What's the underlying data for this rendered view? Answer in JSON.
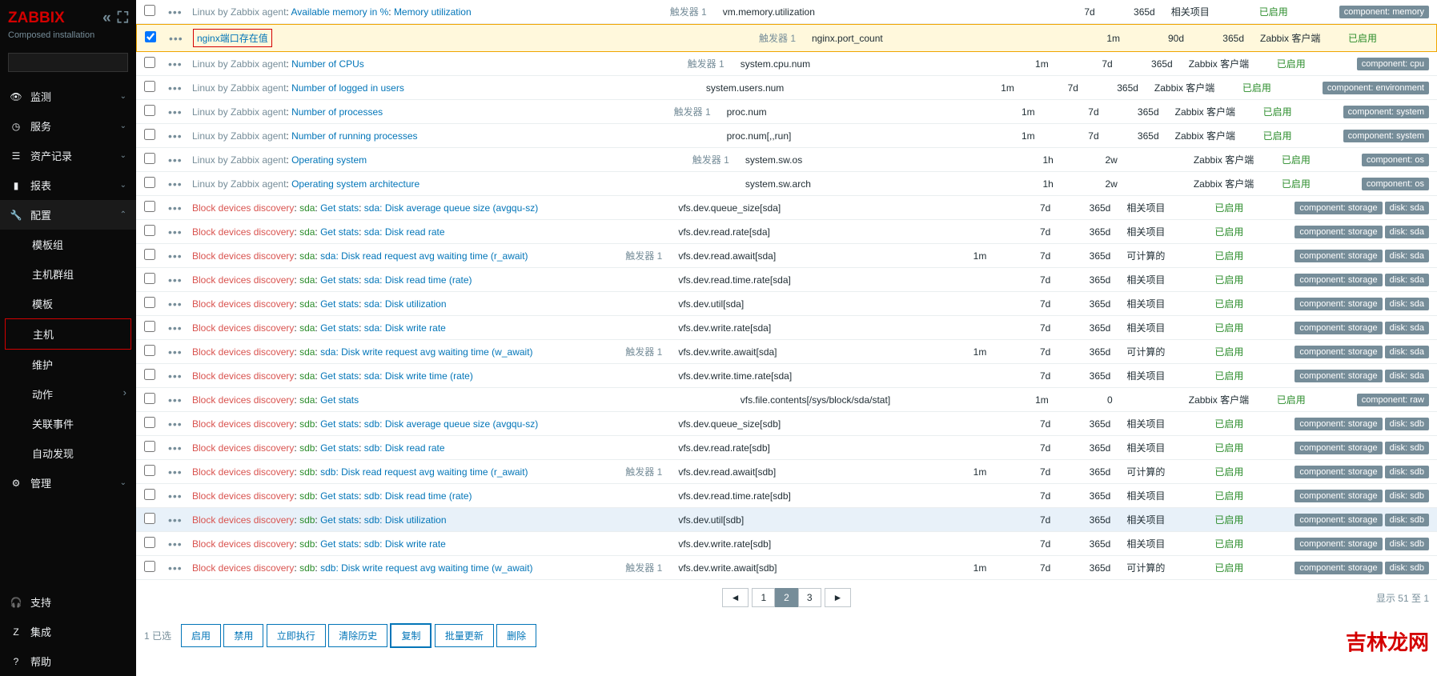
{
  "brand": "ZABBIX",
  "subtitle": "Composed installation",
  "nav": [
    {
      "label": "监测",
      "icon": "eye",
      "chevron": "down"
    },
    {
      "label": "服务",
      "icon": "clock",
      "chevron": "down"
    },
    {
      "label": "资产记录",
      "icon": "list",
      "chevron": "down"
    },
    {
      "label": "报表",
      "icon": "chart",
      "chevron": "down"
    },
    {
      "label": "配置",
      "icon": "wrench",
      "chevron": "up",
      "sub": [
        {
          "label": "模板组"
        },
        {
          "label": "主机群组"
        },
        {
          "label": "模板"
        },
        {
          "label": "主机",
          "boxed": true
        },
        {
          "label": "维护"
        },
        {
          "label": "动作",
          "chevron": "right"
        },
        {
          "label": "关联事件"
        },
        {
          "label": "自动发现"
        }
      ]
    },
    {
      "label": "管理",
      "icon": "gear",
      "chevron": "down"
    }
  ],
  "bottom_nav": [
    {
      "label": "支持",
      "icon": "headset"
    },
    {
      "label": "集成",
      "icon": "z"
    },
    {
      "label": "帮助",
      "icon": "question"
    }
  ],
  "trigger_label": "触发器",
  "status_enabled": "已启用",
  "rows": [
    {
      "prefix_parts": [
        {
          "t": "Linux by Zabbix agent",
          "c": "gray"
        },
        {
          "t": "Available memory in %",
          "c": "blue"
        },
        {
          "t": "Memory utilization",
          "c": "blue"
        }
      ],
      "name": "",
      "trigger": 1,
      "key": "vm.memory.utilization",
      "int": "",
      "hist": "7d",
      "trend": "365d",
      "type": "相关项目",
      "tags": [
        "component: memory"
      ]
    },
    {
      "checked": true,
      "highlight": true,
      "redbox": true,
      "prefix_parts": [],
      "name": "nginx端口存在值",
      "name_c": "blue",
      "trigger": 1,
      "key": "nginx.port_count",
      "int": "1m",
      "hist": "90d",
      "trend": "365d",
      "type": "Zabbix 客户端",
      "tags": []
    },
    {
      "prefix_parts": [
        {
          "t": "Linux by Zabbix agent",
          "c": "gray"
        }
      ],
      "name": "Number of CPUs",
      "name_c": "blue",
      "trigger": 1,
      "key": "system.cpu.num",
      "int": "1m",
      "hist": "7d",
      "trend": "365d",
      "type": "Zabbix 客户端",
      "tags": [
        "component: cpu"
      ]
    },
    {
      "prefix_parts": [
        {
          "t": "Linux by Zabbix agent",
          "c": "gray"
        }
      ],
      "name": "Number of logged in users",
      "name_c": "blue",
      "trigger": "",
      "key": "system.users.num",
      "int": "1m",
      "hist": "7d",
      "trend": "365d",
      "type": "Zabbix 客户端",
      "tags": [
        "component: environment"
      ]
    },
    {
      "prefix_parts": [
        {
          "t": "Linux by Zabbix agent",
          "c": "gray"
        }
      ],
      "name": "Number of processes",
      "name_c": "blue",
      "trigger": 1,
      "key": "proc.num",
      "int": "1m",
      "hist": "7d",
      "trend": "365d",
      "type": "Zabbix 客户端",
      "tags": [
        "component: system"
      ]
    },
    {
      "prefix_parts": [
        {
          "t": "Linux by Zabbix agent",
          "c": "gray"
        }
      ],
      "name": "Number of running processes",
      "name_c": "blue",
      "trigger": "",
      "key": "proc.num[,,run]",
      "int": "1m",
      "hist": "7d",
      "trend": "365d",
      "type": "Zabbix 客户端",
      "tags": [
        "component: system"
      ]
    },
    {
      "prefix_parts": [
        {
          "t": "Linux by Zabbix agent",
          "c": "gray"
        }
      ],
      "name": "Operating system",
      "name_c": "blue",
      "trigger": 1,
      "key": "system.sw.os",
      "int": "1h",
      "hist": "2w",
      "trend": "",
      "type": "Zabbix 客户端",
      "tags": [
        "component: os"
      ]
    },
    {
      "prefix_parts": [
        {
          "t": "Linux by Zabbix agent",
          "c": "gray"
        }
      ],
      "name": "Operating system architecture",
      "name_c": "blue",
      "trigger": "",
      "key": "system.sw.arch",
      "int": "1h",
      "hist": "2w",
      "trend": "",
      "type": "Zabbix 客户端",
      "tags": [
        "component: os"
      ]
    },
    {
      "prefix_parts": [
        {
          "t": "Block devices discovery",
          "c": "orange"
        },
        {
          "t": "sda",
          "c": "green"
        },
        {
          "t": "Get stats",
          "c": "blue"
        }
      ],
      "name": "sda: Disk average queue size (avgqu-sz)",
      "name_c": "blue",
      "trigger": "",
      "key": "vfs.dev.queue_size[sda]",
      "int": "",
      "hist": "7d",
      "trend": "365d",
      "type": "相关项目",
      "tags": [
        "component: storage",
        "disk: sda"
      ]
    },
    {
      "prefix_parts": [
        {
          "t": "Block devices discovery",
          "c": "orange"
        },
        {
          "t": "sda",
          "c": "green"
        },
        {
          "t": "Get stats",
          "c": "blue"
        }
      ],
      "name": "sda: Disk read rate",
      "name_c": "blue",
      "trigger": "",
      "key": "vfs.dev.read.rate[sda]",
      "int": "",
      "hist": "7d",
      "trend": "365d",
      "type": "相关项目",
      "tags": [
        "component: storage",
        "disk: sda"
      ]
    },
    {
      "prefix_parts": [
        {
          "t": "Block devices discovery",
          "c": "orange"
        },
        {
          "t": "sda",
          "c": "green"
        }
      ],
      "name": "sda: Disk read request avg waiting time (r_await)",
      "name_c": "blue",
      "trigger": 1,
      "key": "vfs.dev.read.await[sda]",
      "int": "1m",
      "hist": "7d",
      "trend": "365d",
      "type": "可计算的",
      "tags": [
        "component: storage",
        "disk: sda"
      ]
    },
    {
      "prefix_parts": [
        {
          "t": "Block devices discovery",
          "c": "orange"
        },
        {
          "t": "sda",
          "c": "green"
        },
        {
          "t": "Get stats",
          "c": "blue"
        }
      ],
      "name": "sda: Disk read time (rate)",
      "name_c": "blue",
      "trigger": "",
      "key": "vfs.dev.read.time.rate[sda]",
      "int": "",
      "hist": "7d",
      "trend": "365d",
      "type": "相关项目",
      "tags": [
        "component: storage",
        "disk: sda"
      ]
    },
    {
      "prefix_parts": [
        {
          "t": "Block devices discovery",
          "c": "orange"
        },
        {
          "t": "sda",
          "c": "green"
        },
        {
          "t": "Get stats",
          "c": "blue"
        }
      ],
      "name": "sda: Disk utilization",
      "name_c": "blue",
      "trigger": "",
      "key": "vfs.dev.util[sda]",
      "int": "",
      "hist": "7d",
      "trend": "365d",
      "type": "相关项目",
      "tags": [
        "component: storage",
        "disk: sda"
      ]
    },
    {
      "prefix_parts": [
        {
          "t": "Block devices discovery",
          "c": "orange"
        },
        {
          "t": "sda",
          "c": "green"
        },
        {
          "t": "Get stats",
          "c": "blue"
        }
      ],
      "name": "sda: Disk write rate",
      "name_c": "blue",
      "trigger": "",
      "key": "vfs.dev.write.rate[sda]",
      "int": "",
      "hist": "7d",
      "trend": "365d",
      "type": "相关项目",
      "tags": [
        "component: storage",
        "disk: sda"
      ]
    },
    {
      "prefix_parts": [
        {
          "t": "Block devices discovery",
          "c": "orange"
        },
        {
          "t": "sda",
          "c": "green"
        }
      ],
      "name": "sda: Disk write request avg waiting time (w_await)",
      "name_c": "blue",
      "trigger": 1,
      "key": "vfs.dev.write.await[sda]",
      "int": "1m",
      "hist": "7d",
      "trend": "365d",
      "type": "可计算的",
      "tags": [
        "component: storage",
        "disk: sda"
      ]
    },
    {
      "prefix_parts": [
        {
          "t": "Block devices discovery",
          "c": "orange"
        },
        {
          "t": "sda",
          "c": "green"
        },
        {
          "t": "Get stats",
          "c": "blue"
        }
      ],
      "name": "sda: Disk write time (rate)",
      "name_c": "blue",
      "trigger": "",
      "key": "vfs.dev.write.time.rate[sda]",
      "int": "",
      "hist": "7d",
      "trend": "365d",
      "type": "相关项目",
      "tags": [
        "component: storage",
        "disk: sda"
      ]
    },
    {
      "prefix_parts": [
        {
          "t": "Block devices discovery",
          "c": "orange"
        },
        {
          "t": "sda",
          "c": "green"
        }
      ],
      "name": "Get stats",
      "name_c": "blue",
      "trigger": "",
      "key": "vfs.file.contents[/sys/block/sda/stat]",
      "int": "1m",
      "hist": "0",
      "trend": "",
      "type": "Zabbix 客户端",
      "tags": [
        "component: raw"
      ]
    },
    {
      "prefix_parts": [
        {
          "t": "Block devices discovery",
          "c": "orange"
        },
        {
          "t": "sdb",
          "c": "green"
        },
        {
          "t": "Get stats",
          "c": "blue"
        }
      ],
      "name": "sdb: Disk average queue size (avgqu-sz)",
      "name_c": "blue",
      "trigger": "",
      "key": "vfs.dev.queue_size[sdb]",
      "int": "",
      "hist": "7d",
      "trend": "365d",
      "type": "相关项目",
      "tags": [
        "component: storage",
        "disk: sdb"
      ]
    },
    {
      "prefix_parts": [
        {
          "t": "Block devices discovery",
          "c": "orange"
        },
        {
          "t": "sdb",
          "c": "green"
        },
        {
          "t": "Get stats",
          "c": "blue"
        }
      ],
      "name": "sdb: Disk read rate",
      "name_c": "blue",
      "trigger": "",
      "key": "vfs.dev.read.rate[sdb]",
      "int": "",
      "hist": "7d",
      "trend": "365d",
      "type": "相关项目",
      "tags": [
        "component: storage",
        "disk: sdb"
      ]
    },
    {
      "prefix_parts": [
        {
          "t": "Block devices discovery",
          "c": "orange"
        },
        {
          "t": "sdb",
          "c": "green"
        }
      ],
      "name": "sdb: Disk read request avg waiting time (r_await)",
      "name_c": "blue",
      "trigger": 1,
      "key": "vfs.dev.read.await[sdb]",
      "int": "1m",
      "hist": "7d",
      "trend": "365d",
      "type": "可计算的",
      "tags": [
        "component: storage",
        "disk: sdb"
      ]
    },
    {
      "prefix_parts": [
        {
          "t": "Block devices discovery",
          "c": "orange"
        },
        {
          "t": "sdb",
          "c": "green"
        },
        {
          "t": "Get stats",
          "c": "blue"
        }
      ],
      "name": "sdb: Disk read time (rate)",
      "name_c": "blue",
      "trigger": "",
      "key": "vfs.dev.read.time.rate[sdb]",
      "int": "",
      "hist": "7d",
      "trend": "365d",
      "type": "相关项目",
      "tags": [
        "component: storage",
        "disk: sdb"
      ]
    },
    {
      "hover": true,
      "prefix_parts": [
        {
          "t": "Block devices discovery",
          "c": "orange"
        },
        {
          "t": "sdb",
          "c": "green"
        },
        {
          "t": "Get stats",
          "c": "blue"
        }
      ],
      "name": "sdb: Disk utilization",
      "name_c": "blue",
      "trigger": "",
      "key": "vfs.dev.util[sdb]",
      "int": "",
      "hist": "7d",
      "trend": "365d",
      "type": "相关项目",
      "tags": [
        "component: storage",
        "disk: sdb"
      ]
    },
    {
      "prefix_parts": [
        {
          "t": "Block devices discovery",
          "c": "orange"
        },
        {
          "t": "sdb",
          "c": "green"
        },
        {
          "t": "Get stats",
          "c": "blue"
        }
      ],
      "name": "sdb: Disk write rate",
      "name_c": "blue",
      "trigger": "",
      "key": "vfs.dev.write.rate[sdb]",
      "int": "",
      "hist": "7d",
      "trend": "365d",
      "type": "相关项目",
      "tags": [
        "component: storage",
        "disk: sdb"
      ]
    },
    {
      "prefix_parts": [
        {
          "t": "Block devices discovery",
          "c": "orange"
        },
        {
          "t": "sdb",
          "c": "green"
        }
      ],
      "name": "sdb: Disk write request avg waiting time (w_await)",
      "name_c": "blue",
      "trigger": 1,
      "key": "vfs.dev.write.await[sdb]",
      "int": "1m",
      "hist": "7d",
      "trend": "365d",
      "type": "可计算的",
      "tags": [
        "component: storage",
        "disk: sdb"
      ]
    }
  ],
  "pagination": {
    "pages": [
      "1",
      "2",
      "3"
    ],
    "active": "2",
    "info": "显示 51 至 1"
  },
  "footer": {
    "selected": "1 已选",
    "buttons": [
      "启用",
      "禁用",
      "立即执行",
      "清除历史",
      "复制",
      "批量更新",
      "删除"
    ],
    "outlined_index": 4
  },
  "watermark": "吉林龙网"
}
